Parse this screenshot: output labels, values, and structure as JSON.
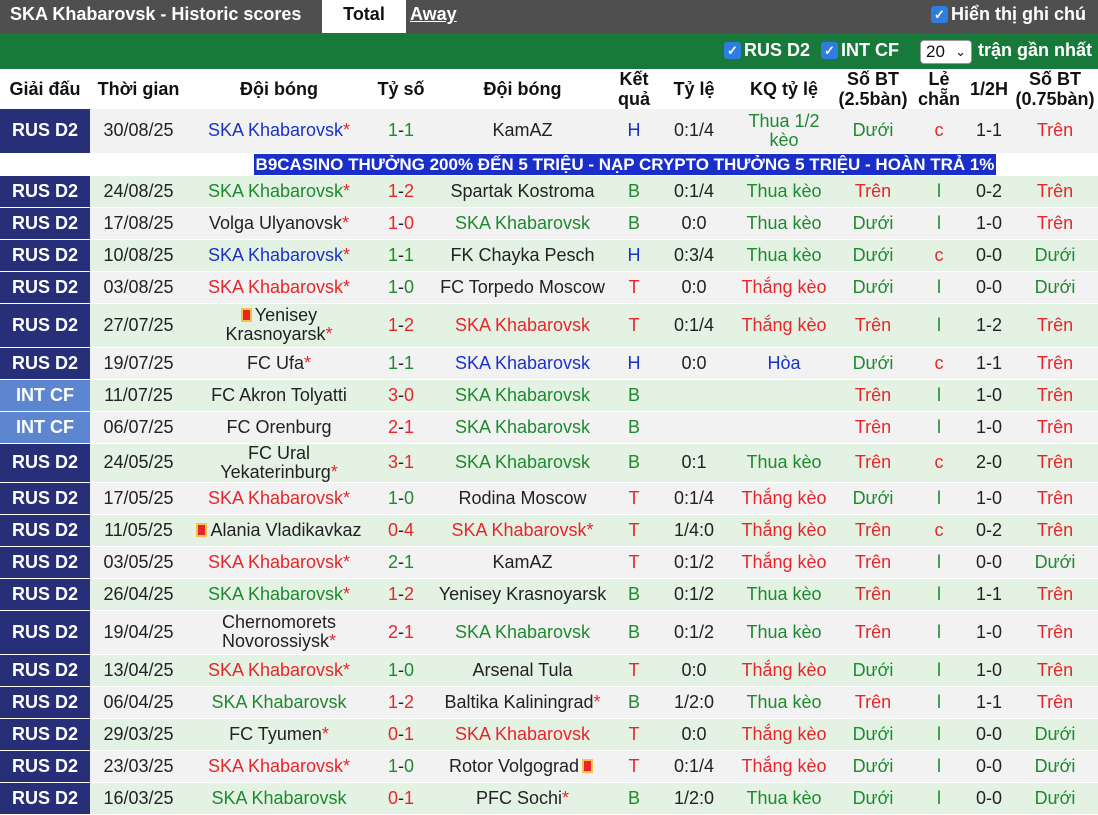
{
  "header": {
    "title": "SKA Khabarovsk - Historic scores",
    "tab_total": "Total",
    "tab_away": "Away",
    "show_all_label": "Hiển thị ghi chú"
  },
  "filters": {
    "league1": "RUS D2",
    "league2": "INT CF",
    "count": "20",
    "recent_label": "trận gần nhất"
  },
  "columns": {
    "league": "Giải đấu",
    "time": "Thời gian",
    "home": "Đội bóng",
    "score": "Tỷ số",
    "away": "Đội bóng",
    "result": "Kết quả",
    "odds": "Tỷ lệ",
    "odds_result": "KQ tỷ lệ",
    "goals": "Số BT (2.5bàn)",
    "oddeven": "Lẻ chẵn",
    "half": "1/2H",
    "goals075": "Số BT (0.75bàn)"
  },
  "colors": {
    "topbar": "#4f4f4f",
    "filterbar": "#177a3a",
    "league_rus": "#272f78",
    "league_int": "#5d86d0",
    "green": "#1d8a2e",
    "blue": "#1b32c7",
    "red": "#e8262a"
  },
  "banner": "B9CASINO THƯỞNG 200% ĐẾN 5 TRIỆU - NẠP CRYPTO THƯỞNG 5 TRIỆU - HOÀN TRẢ 1%",
  "rows": [
    {
      "league": "RUS D2",
      "int": false,
      "date": "30/08/25",
      "home": "SKA Khabarovsk",
      "home_star": true,
      "home_color": "blue",
      "home_flag": false,
      "score_h": "1",
      "score_a": "1",
      "score_color": "green",
      "away": "KamAZ",
      "away_star": false,
      "away_color": "dark",
      "away_flag": false,
      "res": "H",
      "res_color": "blue",
      "odds": "0:1/4",
      "kq": "Thua 1/2 kèo",
      "kq_color": "green",
      "bt": "Dưới",
      "bt_color": "green",
      "le": "c",
      "le_color": "red",
      "half": "1-1",
      "bt75": "Trên",
      "bt75_color": "red",
      "tall": true
    },
    {
      "banner": true
    },
    {
      "league": "RUS D2",
      "int": false,
      "date": "24/08/25",
      "home": "SKA Khabarovsk",
      "home_star": true,
      "home_color": "green",
      "home_flag": false,
      "score_h": "1",
      "score_a": "2",
      "score_color": "red",
      "away": "Spartak Kostroma",
      "away_star": false,
      "away_color": "dark",
      "away_flag": false,
      "res": "B",
      "res_color": "green",
      "odds": "0:1/4",
      "kq": "Thua kèo",
      "kq_color": "green",
      "bt": "Trên",
      "bt_color": "red",
      "le": "l",
      "le_color": "green",
      "half": "0-2",
      "bt75": "Trên",
      "bt75_color": "red"
    },
    {
      "league": "RUS D2",
      "int": false,
      "date": "17/08/25",
      "home": "Volga Ulyanovsk",
      "home_star": true,
      "home_color": "dark",
      "home_flag": false,
      "score_h": "1",
      "score_a": "0",
      "score_color": "red",
      "away": "SKA Khabarovsk",
      "away_star": false,
      "away_color": "green",
      "away_flag": false,
      "res": "B",
      "res_color": "green",
      "odds": "0:0",
      "kq": "Thua kèo",
      "kq_color": "green",
      "bt": "Dưới",
      "bt_color": "green",
      "le": "l",
      "le_color": "green",
      "half": "1-0",
      "bt75": "Trên",
      "bt75_color": "red"
    },
    {
      "league": "RUS D2",
      "int": false,
      "date": "10/08/25",
      "home": "SKA Khabarovsk",
      "home_star": true,
      "home_color": "blue",
      "home_flag": false,
      "score_h": "1",
      "score_a": "1",
      "score_color": "green",
      "away": "FK Chayka Pesch",
      "away_star": false,
      "away_color": "dark",
      "away_flag": false,
      "res": "H",
      "res_color": "blue",
      "odds": "0:3/4",
      "kq": "Thua kèo",
      "kq_color": "green",
      "bt": "Dưới",
      "bt_color": "green",
      "le": "c",
      "le_color": "red",
      "half": "0-0",
      "bt75": "Dưới",
      "bt75_color": "green"
    },
    {
      "league": "RUS D2",
      "int": false,
      "date": "03/08/25",
      "home": "SKA Khabarovsk",
      "home_star": true,
      "home_color": "red",
      "home_flag": false,
      "score_h": "1",
      "score_a": "0",
      "score_color": "green",
      "away": "FC Torpedo Moscow",
      "away_star": false,
      "away_color": "dark",
      "away_flag": false,
      "res": "T",
      "res_color": "red",
      "odds": "0:0",
      "kq": "Thắng kèo",
      "kq_color": "red",
      "bt": "Dưới",
      "bt_color": "green",
      "le": "l",
      "le_color": "green",
      "half": "0-0",
      "bt75": "Dưới",
      "bt75_color": "green"
    },
    {
      "league": "RUS D2",
      "int": false,
      "date": "27/07/25",
      "home": "Yenisey Krasnoyarsk",
      "home_star": true,
      "home_color": "dark",
      "home_flag": true,
      "score_h": "1",
      "score_a": "2",
      "score_color": "red",
      "away": "SKA Khabarovsk",
      "away_star": false,
      "away_color": "red",
      "away_flag": false,
      "res": "T",
      "res_color": "red",
      "odds": "0:1/4",
      "kq": "Thắng kèo",
      "kq_color": "red",
      "bt": "Trên",
      "bt_color": "red",
      "le": "l",
      "le_color": "green",
      "half": "1-2",
      "bt75": "Trên",
      "bt75_color": "red",
      "tall": true
    },
    {
      "league": "RUS D2",
      "int": false,
      "date": "19/07/25",
      "home": "FC Ufa",
      "home_star": true,
      "home_color": "dark",
      "home_flag": false,
      "score_h": "1",
      "score_a": "1",
      "score_color": "green",
      "away": "SKA Khabarovsk",
      "away_star": false,
      "away_color": "blue",
      "away_flag": false,
      "res": "H",
      "res_color": "blue",
      "odds": "0:0",
      "kq": "Hòa",
      "kq_color": "blue",
      "bt": "Dưới",
      "bt_color": "green",
      "le": "c",
      "le_color": "red",
      "half": "1-1",
      "bt75": "Trên",
      "bt75_color": "red"
    },
    {
      "league": "INT CF",
      "int": true,
      "date": "11/07/25",
      "home": "FC Akron Tolyatti",
      "home_star": false,
      "home_color": "dark",
      "home_flag": false,
      "score_h": "3",
      "score_a": "0",
      "score_color": "red",
      "away": "SKA Khabarovsk",
      "away_star": false,
      "away_color": "green",
      "away_flag": false,
      "res": "B",
      "res_color": "green",
      "odds": "",
      "kq": "",
      "kq_color": "green",
      "bt": "Trên",
      "bt_color": "red",
      "le": "l",
      "le_color": "green",
      "half": "1-0",
      "bt75": "Trên",
      "bt75_color": "red"
    },
    {
      "league": "INT CF",
      "int": true,
      "date": "06/07/25",
      "home": "FC Orenburg",
      "home_star": false,
      "home_color": "dark",
      "home_flag": false,
      "score_h": "2",
      "score_a": "1",
      "score_color": "red",
      "away": "SKA Khabarovsk",
      "away_star": false,
      "away_color": "green",
      "away_flag": false,
      "res": "B",
      "res_color": "green",
      "odds": "",
      "kq": "",
      "kq_color": "green",
      "bt": "Trên",
      "bt_color": "red",
      "le": "l",
      "le_color": "green",
      "half": "1-0",
      "bt75": "Trên",
      "bt75_color": "red"
    },
    {
      "league": "RUS D2",
      "int": false,
      "date": "24/05/25",
      "home": "FC Ural Yekaterinburg",
      "home_star": true,
      "home_color": "dark",
      "home_flag": false,
      "score_h": "3",
      "score_a": "1",
      "score_color": "red",
      "away": "SKA Khabarovsk",
      "away_star": false,
      "away_color": "green",
      "away_flag": false,
      "res": "B",
      "res_color": "green",
      "odds": "0:1",
      "kq": "Thua kèo",
      "kq_color": "green",
      "bt": "Trên",
      "bt_color": "red",
      "le": "c",
      "le_color": "red",
      "half": "2-0",
      "bt75": "Trên",
      "bt75_color": "red"
    },
    {
      "league": "RUS D2",
      "int": false,
      "date": "17/05/25",
      "home": "SKA Khabarovsk",
      "home_star": true,
      "home_color": "red",
      "home_flag": false,
      "score_h": "1",
      "score_a": "0",
      "score_color": "green",
      "away": "Rodina Moscow",
      "away_star": false,
      "away_color": "dark",
      "away_flag": false,
      "res": "T",
      "res_color": "red",
      "odds": "0:1/4",
      "kq": "Thắng kèo",
      "kq_color": "red",
      "bt": "Dưới",
      "bt_color": "green",
      "le": "l",
      "le_color": "green",
      "half": "1-0",
      "bt75": "Trên",
      "bt75_color": "red"
    },
    {
      "league": "RUS D2",
      "int": false,
      "date": "11/05/25",
      "home": "Alania Vladikavkaz",
      "home_star": false,
      "home_color": "dark",
      "home_flag": true,
      "score_h": "0",
      "score_a": "4",
      "score_color": "red",
      "away": "SKA Khabarovsk",
      "away_star": true,
      "away_color": "red",
      "away_flag": false,
      "res": "T",
      "res_color": "red",
      "odds": "1/4:0",
      "kq": "Thắng kèo",
      "kq_color": "red",
      "bt": "Trên",
      "bt_color": "red",
      "le": "c",
      "le_color": "red",
      "half": "0-2",
      "bt75": "Trên",
      "bt75_color": "red"
    },
    {
      "league": "RUS D2",
      "int": false,
      "date": "03/05/25",
      "home": "SKA Khabarovsk",
      "home_star": true,
      "home_color": "red",
      "home_flag": false,
      "score_h": "2",
      "score_a": "1",
      "score_color": "green",
      "away": "KamAZ",
      "away_star": false,
      "away_color": "dark",
      "away_flag": false,
      "res": "T",
      "res_color": "red",
      "odds": "0:1/2",
      "kq": "Thắng kèo",
      "kq_color": "red",
      "bt": "Trên",
      "bt_color": "red",
      "le": "l",
      "le_color": "green",
      "half": "0-0",
      "bt75": "Dưới",
      "bt75_color": "green"
    },
    {
      "league": "RUS D2",
      "int": false,
      "date": "26/04/25",
      "home": "SKA Khabarovsk",
      "home_star": true,
      "home_color": "green",
      "home_flag": false,
      "score_h": "1",
      "score_a": "2",
      "score_color": "red",
      "away": "Yenisey Krasnoyarsk",
      "away_star": false,
      "away_color": "dark",
      "away_flag": false,
      "res": "B",
      "res_color": "green",
      "odds": "0:1/2",
      "kq": "Thua kèo",
      "kq_color": "green",
      "bt": "Trên",
      "bt_color": "red",
      "le": "l",
      "le_color": "green",
      "half": "1-1",
      "bt75": "Trên",
      "bt75_color": "red"
    },
    {
      "league": "RUS D2",
      "int": false,
      "date": "19/04/25",
      "home": "Chernomorets Novorossiysk",
      "home_star": true,
      "home_color": "dark",
      "home_flag": false,
      "score_h": "2",
      "score_a": "1",
      "score_color": "red",
      "away": "SKA Khabarovsk",
      "away_star": false,
      "away_color": "green",
      "away_flag": false,
      "res": "B",
      "res_color": "green",
      "odds": "0:1/2",
      "kq": "Thua kèo",
      "kq_color": "green",
      "bt": "Trên",
      "bt_color": "red",
      "le": "l",
      "le_color": "green",
      "half": "1-0",
      "bt75": "Trên",
      "bt75_color": "red",
      "tall": true
    },
    {
      "league": "RUS D2",
      "int": false,
      "date": "13/04/25",
      "home": "SKA Khabarovsk",
      "home_star": true,
      "home_color": "red",
      "home_flag": false,
      "score_h": "1",
      "score_a": "0",
      "score_color": "green",
      "away": "Arsenal Tula",
      "away_star": false,
      "away_color": "dark",
      "away_flag": false,
      "res": "T",
      "res_color": "red",
      "odds": "0:0",
      "kq": "Thắng kèo",
      "kq_color": "red",
      "bt": "Dưới",
      "bt_color": "green",
      "le": "l",
      "le_color": "green",
      "half": "1-0",
      "bt75": "Trên",
      "bt75_color": "red"
    },
    {
      "league": "RUS D2",
      "int": false,
      "date": "06/04/25",
      "home": "SKA Khabarovsk",
      "home_star": false,
      "home_color": "green",
      "home_flag": false,
      "score_h": "1",
      "score_a": "2",
      "score_color": "red",
      "away": "Baltika Kaliningrad",
      "away_star": true,
      "away_color": "dark",
      "away_flag": false,
      "res": "B",
      "res_color": "green",
      "odds": "1/2:0",
      "kq": "Thua kèo",
      "kq_color": "green",
      "bt": "Trên",
      "bt_color": "red",
      "le": "l",
      "le_color": "green",
      "half": "1-1",
      "bt75": "Trên",
      "bt75_color": "red"
    },
    {
      "league": "RUS D2",
      "int": false,
      "date": "29/03/25",
      "home": "FC Tyumen",
      "home_star": true,
      "home_color": "dark",
      "home_flag": false,
      "score_h": "0",
      "score_a": "1",
      "score_color": "red",
      "away": "SKA Khabarovsk",
      "away_star": false,
      "away_color": "red",
      "away_flag": false,
      "res": "T",
      "res_color": "red",
      "odds": "0:0",
      "kq": "Thắng kèo",
      "kq_color": "red",
      "bt": "Dưới",
      "bt_color": "green",
      "le": "l",
      "le_color": "green",
      "half": "0-0",
      "bt75": "Dưới",
      "bt75_color": "green"
    },
    {
      "league": "RUS D2",
      "int": false,
      "date": "23/03/25",
      "home": "SKA Khabarovsk",
      "home_star": true,
      "home_color": "red",
      "home_flag": false,
      "score_h": "1",
      "score_a": "0",
      "score_color": "green",
      "away": "Rotor Volgograd",
      "away_star": false,
      "away_color": "dark",
      "away_flag": true,
      "res": "T",
      "res_color": "red",
      "odds": "0:1/4",
      "kq": "Thắng kèo",
      "kq_color": "red",
      "bt": "Dưới",
      "bt_color": "green",
      "le": "l",
      "le_color": "green",
      "half": "0-0",
      "bt75": "Dưới",
      "bt75_color": "green"
    },
    {
      "league": "RUS D2",
      "int": false,
      "date": "16/03/25",
      "home": "SKA Khabarovsk",
      "home_star": false,
      "home_color": "green",
      "home_flag": false,
      "score_h": "0",
      "score_a": "1",
      "score_color": "red",
      "away": "PFC Sochi",
      "away_star": true,
      "away_color": "dark",
      "away_flag": false,
      "res": "B",
      "res_color": "green",
      "odds": "1/2:0",
      "kq": "Thua kèo",
      "kq_color": "green",
      "bt": "Dưới",
      "bt_color": "green",
      "le": "l",
      "le_color": "green",
      "half": "0-0",
      "bt75": "Dưới",
      "bt75_color": "green"
    }
  ]
}
